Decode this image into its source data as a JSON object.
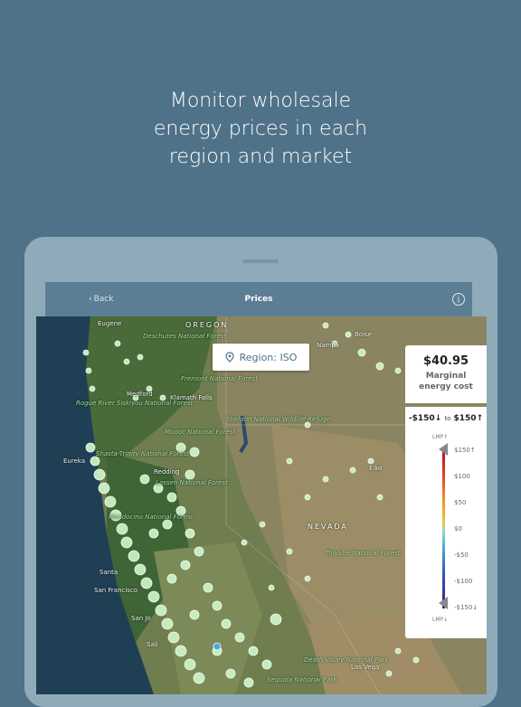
{
  "headline": {
    "line1": "Monitor wholesale",
    "line2": "energy prices in each",
    "line3": "region and market"
  },
  "nav": {
    "back_label": "Back",
    "title": "Prices",
    "info_icon": "info-icon"
  },
  "region_button": {
    "label": "Region: ISO",
    "icon": "location-pin-icon"
  },
  "price_card": {
    "value": "$40.95",
    "label_line1": "Marginal",
    "label_line2": "energy cost"
  },
  "legend": {
    "range_low": "-$150↓",
    "range_to": "to",
    "range_high": "$150↑",
    "top_label": "LMP↑",
    "bottom_label": "LMP↓",
    "ticks": [
      "$150↑",
      "$100",
      "$50",
      "$0",
      "-$50",
      "-$100",
      "-$150↓"
    ],
    "colors": {
      "high": "#b4101e",
      "mid": "#8fd8c8",
      "low": "#3a1d8a"
    }
  },
  "map": {
    "states": [
      "OREGON",
      "NEVADA"
    ],
    "cities": [
      "Eugene",
      "Boise",
      "Nampa",
      "Medford",
      "Klamath Falls",
      "Eureka",
      "Redding",
      "Elko",
      "Santa",
      "San Francisco",
      "San Jo",
      "Sali",
      "Las Vega"
    ],
    "parks": [
      "Deschutes National Forest",
      "Fremont National Forest",
      "Rogue River Siskiyou National Forest",
      "Sheldon National Wildlife Refuge",
      "Modoc National Forest",
      "Shasta-Trinity National Forest",
      "Lassen National Forest",
      "Mendocino National Forest",
      "Toiyabe National Forest",
      "Death Valley National Park",
      "Sequoia National Park"
    ],
    "marker_color": "#c9f2c2"
  }
}
